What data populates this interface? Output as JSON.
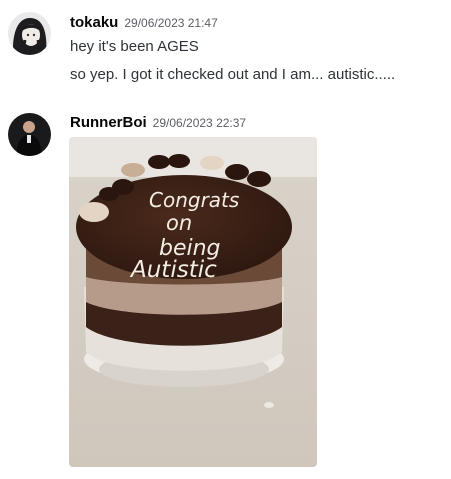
{
  "messages": [
    {
      "author": "tokaku",
      "timestamp": "29/06/2023 21:47",
      "lines": [
        "hey it's been AGES",
        "so yep. I got it checked out and I am... autistic....."
      ]
    },
    {
      "author": "RunnerBoi",
      "timestamp": "29/06/2023 22:37",
      "attachment": {
        "type": "image",
        "description_text": [
          "Congrats",
          "on",
          "being",
          "Autistic"
        ]
      }
    }
  ],
  "colors": {
    "author": "#060607",
    "timestamp": "#5c5e66",
    "text": "#2e3338",
    "frosting": "#3a2116",
    "icing": "#f4ede4"
  }
}
